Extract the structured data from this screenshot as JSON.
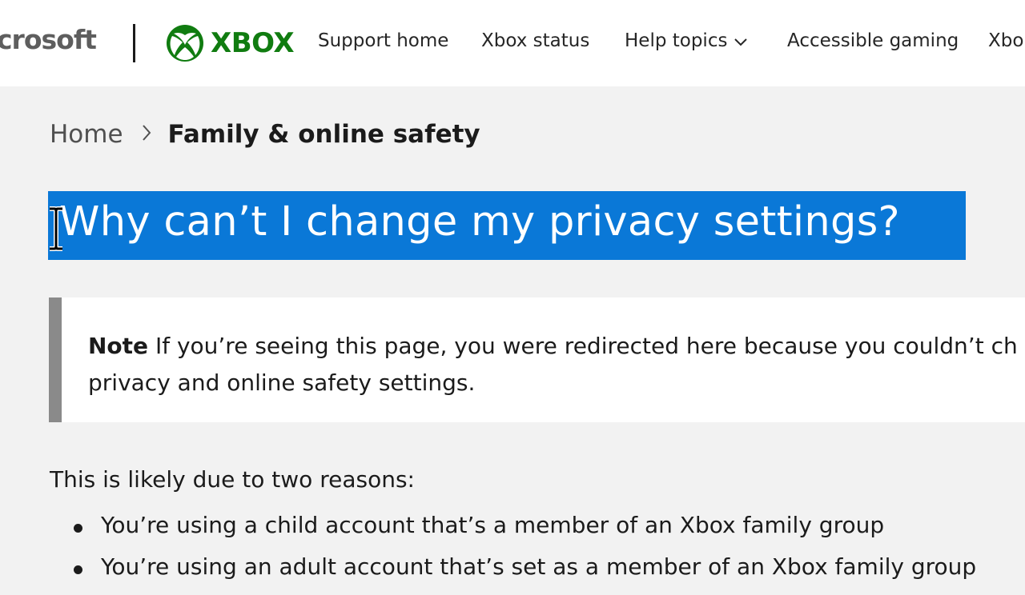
{
  "header": {
    "brand_text": "crosoft",
    "xbox_text": "XBOX",
    "nav": [
      {
        "label": "Support home"
      },
      {
        "label": "Xbox status"
      },
      {
        "label": "Help topics",
        "icon": "chevron-down-icon"
      },
      {
        "label": "Accessible gaming"
      },
      {
        "label": "Xbo"
      }
    ],
    "colors": {
      "xbox_green": "#107c10"
    }
  },
  "breadcrumb": {
    "home": "Home",
    "separator_icon": "chevron-right-icon",
    "current": "Family & online safety"
  },
  "article": {
    "title": "Why can’t I change my privacy settings?",
    "title_selection_color": "#0a78d7",
    "note": {
      "label": "Note",
      "line1": " If you’re seeing this page, you were redirected here because you couldn’t ch",
      "line2": "privacy and online safety settings."
    },
    "intro": "This is likely due to two reasons:",
    "bullets": [
      "You’re using a child account that’s a member of an Xbox family group",
      "You’re using an adult account that’s set as a member of an Xbox family group"
    ]
  }
}
